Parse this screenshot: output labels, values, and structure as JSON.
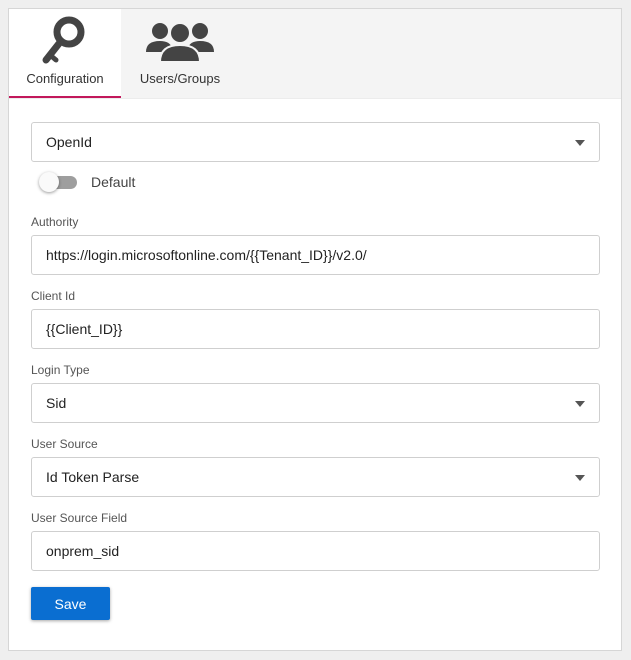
{
  "tabs": [
    {
      "label": "Configuration",
      "icon": "key-icon",
      "active": true
    },
    {
      "label": "Users/Groups",
      "icon": "users-icon",
      "active": false
    }
  ],
  "form": {
    "provider": {
      "value": "OpenId"
    },
    "default_toggle": {
      "label": "Default",
      "on": false
    },
    "authority": {
      "label": "Authority",
      "value": "https://login.microsoftonline.com/{{Tenant_ID}}/v2.0/"
    },
    "client_id": {
      "label": "Client Id",
      "value": "{{Client_ID}}"
    },
    "login_type": {
      "label": "Login Type",
      "value": "Sid"
    },
    "user_source": {
      "label": "User Source",
      "value": "Id Token Parse"
    },
    "user_source_field": {
      "label": "User Source Field",
      "value": "onprem_sid"
    },
    "save_label": "Save"
  },
  "colors": {
    "accent": "#c2185b",
    "primary_button": "#0a6ed1",
    "icon": "#444444"
  }
}
